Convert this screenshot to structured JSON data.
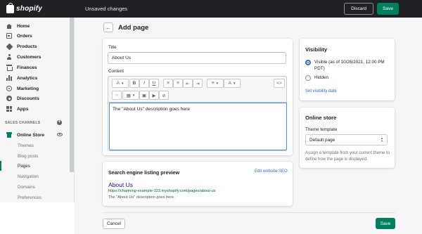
{
  "topbar": {
    "logo_text": "shopify",
    "status": "Unsaved changes",
    "discard_label": "Discard",
    "save_label": "Save"
  },
  "sidebar": {
    "items": [
      {
        "label": "Home",
        "icon": "home-icon"
      },
      {
        "label": "Orders",
        "icon": "orders-icon"
      },
      {
        "label": "Products",
        "icon": "tag-icon"
      },
      {
        "label": "Customers",
        "icon": "person-icon"
      },
      {
        "label": "Finances",
        "icon": "bank-icon"
      },
      {
        "label": "Analytics",
        "icon": "bar-chart-icon"
      },
      {
        "label": "Marketing",
        "icon": "target-icon"
      },
      {
        "label": "Discounts",
        "icon": "gear-icon"
      },
      {
        "label": "Apps",
        "icon": "apps-grid-icon"
      }
    ],
    "sales_channels_label": "SALES CHANNELS",
    "online_store_label": "Online Store",
    "sub_items": [
      "Themes",
      "Blog posts",
      "Pages",
      "Navigation",
      "Domains",
      "Preferences"
    ],
    "active_sub_item": "Pages",
    "accent_color": "#008060"
  },
  "page": {
    "title": "Add page",
    "back_icon": "arrow-left-icon"
  },
  "form": {
    "title_label": "Title",
    "title_value": "About Us",
    "content_label": "Content",
    "content_text": "The \"About Us\" description goes here",
    "toolbar_icons": [
      "font-icon",
      "bold-icon",
      "italic-icon",
      "underline-icon",
      "bulleted-list-icon",
      "numbered-list-icon",
      "outdent-icon",
      "indent-icon",
      "align-icon",
      "text-color-icon",
      "show-html-icon",
      "link-icon",
      "table-icon",
      "image-icon",
      "video-icon",
      "block-icon"
    ],
    "toolbar_glyphs": {
      "font": "A",
      "bold": "B",
      "italic": "I",
      "underline": "U",
      "html": "<>"
    }
  },
  "visibility": {
    "title": "Visibility",
    "visible_label": "Visible (as of 10/26/2021, 12:00 PM PDT)",
    "hidden_label": "Hidden",
    "selected": "visible",
    "set_date_link": "Set visibility date"
  },
  "online_store": {
    "title": "Online store",
    "template_label": "Theme template",
    "template_value": "Default page",
    "help_text": "Assign a template from your current theme to define how the page is displayed."
  },
  "seo": {
    "title": "Search engine listing preview",
    "edit_link": "Edit website SEO",
    "page_title": "About Us",
    "url": "https://charming-example-123.myshopify.com/pages/about-us",
    "description": "The \"About Us\" description goes here."
  },
  "footer": {
    "cancel_label": "Cancel",
    "save_label": "Save"
  }
}
